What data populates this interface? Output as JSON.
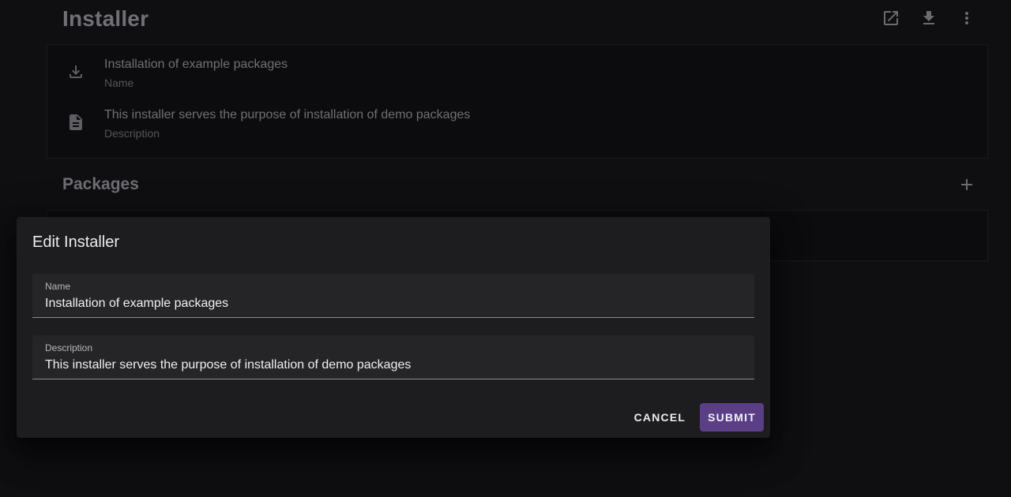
{
  "page": {
    "title": "Installer"
  },
  "info": {
    "name_value": "Installation of example packages",
    "name_label": "Name",
    "description_value": "This installer serves the purpose of installation of demo packages",
    "description_label": "Description"
  },
  "packages": {
    "title": "Packages"
  },
  "icons": {
    "open_external": "open-in-new-icon",
    "download": "download-icon",
    "more": "more-vert-icon",
    "add": "plus-icon",
    "install": "install-icon",
    "description": "document-icon"
  },
  "dialog": {
    "title": "Edit Installer",
    "name_field": {
      "label": "Name",
      "value": "Installation of example packages"
    },
    "description_field": {
      "label": "Description",
      "value": "This installer serves the purpose of installation of demo packages"
    },
    "cancel_label": "Cancel",
    "submit_label": "Submit"
  },
  "colors": {
    "background": "#0f0f12",
    "dialog": "#1d1d20",
    "field": "#252528",
    "accent": "#5b3f86"
  }
}
